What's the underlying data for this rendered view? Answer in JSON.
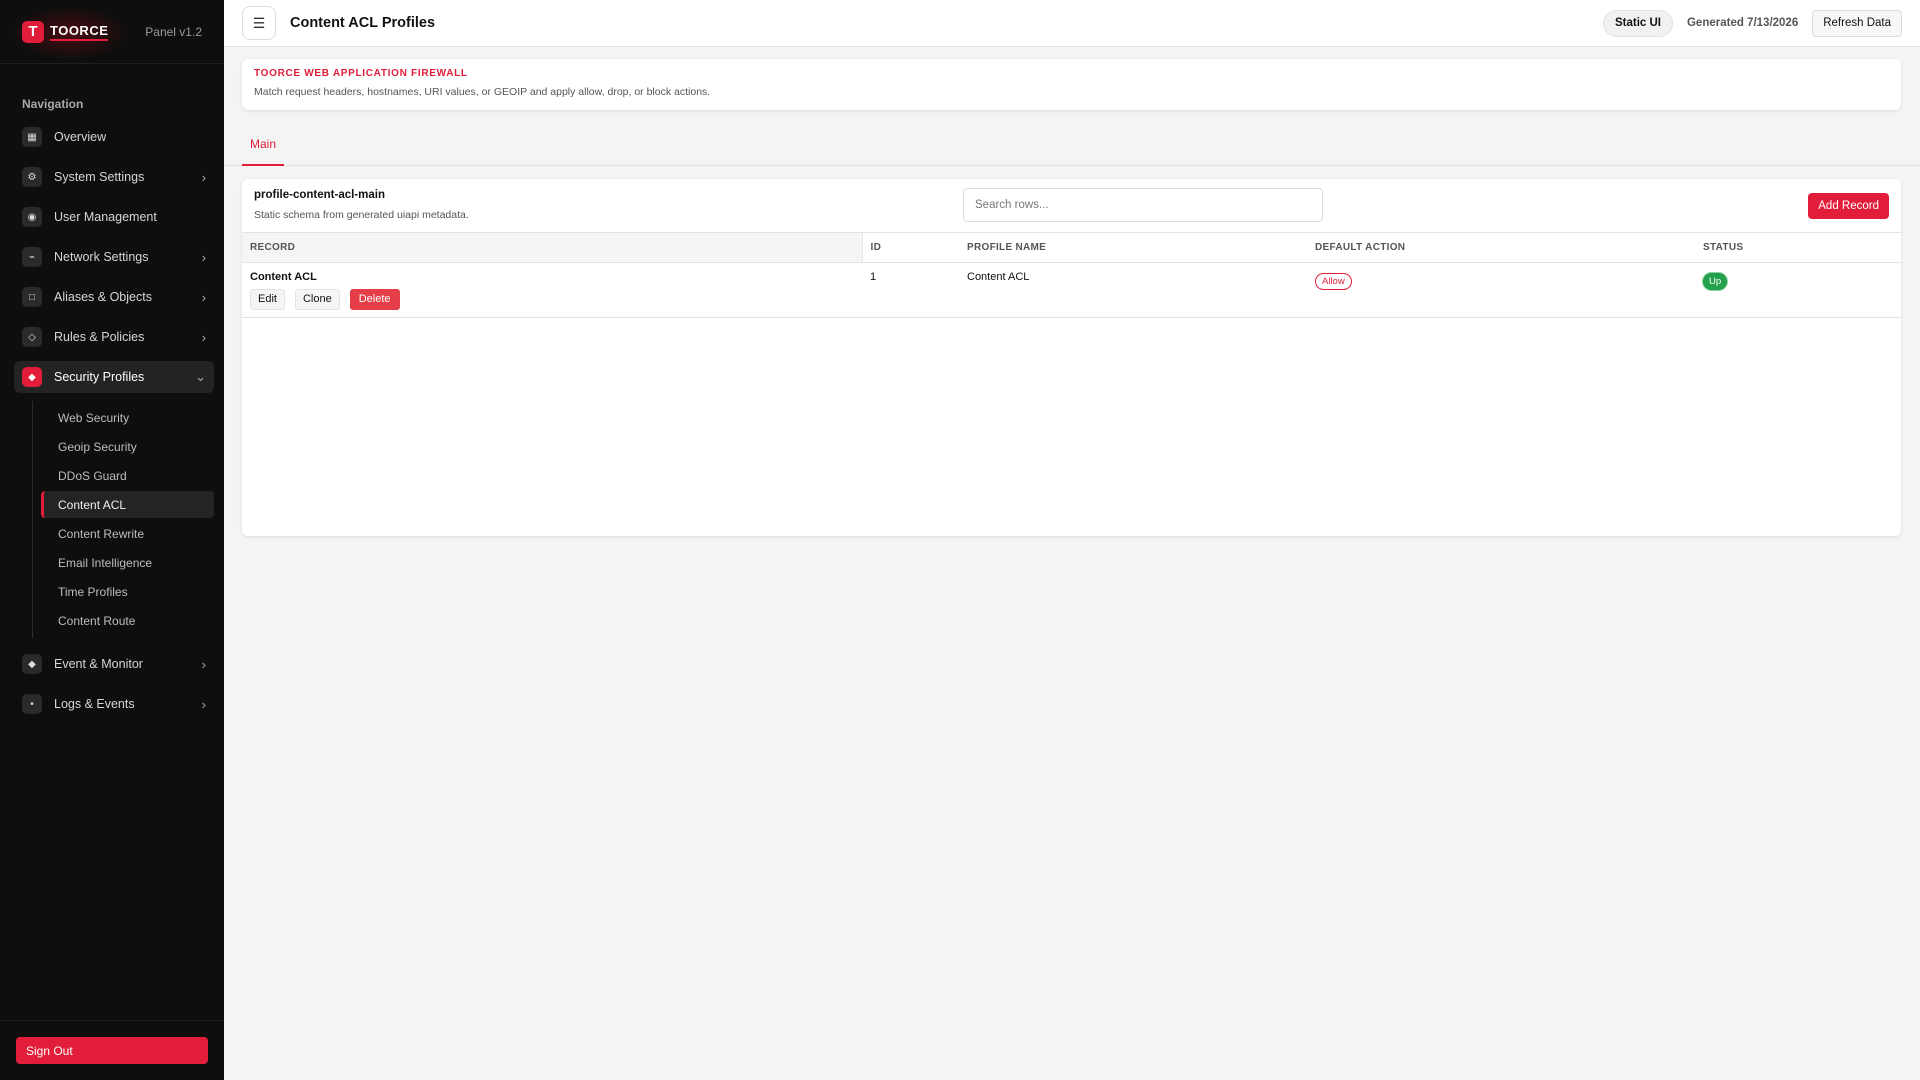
{
  "brand": {
    "logo_letter": "T",
    "name": "TOORCE",
    "panel_version": "Panel v1.2"
  },
  "sidebar": {
    "heading": "Navigation",
    "items": [
      {
        "label": "Overview",
        "icon": "grid-icon",
        "glyph": "▦"
      },
      {
        "label": "System Settings",
        "icon": "gear-icon",
        "glyph": "⚙",
        "chevron": "›"
      },
      {
        "label": "User Management",
        "icon": "user-icon",
        "glyph": "◉"
      },
      {
        "label": "Network Settings",
        "icon": "network-icon",
        "glyph": "⌁",
        "chevron": "›"
      },
      {
        "label": "Aliases & Objects",
        "icon": "square-icon",
        "glyph": "□",
        "chevron": "›"
      },
      {
        "label": "Rules & Policies",
        "icon": "diamond-outline-icon",
        "glyph": "◇",
        "chevron": "›"
      },
      {
        "label": "Security Profiles",
        "icon": "shield-icon",
        "glyph": "◆",
        "chevron": "⌄"
      }
    ],
    "security_sub_items": [
      "Web Security",
      "Geoip Security",
      "DDoS Guard",
      "Content ACL",
      "Content Rewrite",
      "Email Intelligence",
      "Time Profiles",
      "Content Route"
    ],
    "bottom_items": [
      {
        "label": "Event & Monitor",
        "icon": "diamond-icon",
        "glyph": "◆",
        "chevron": "›"
      },
      {
        "label": "Logs & Events",
        "icon": "dot-icon",
        "glyph": "•",
        "chevron": "›"
      }
    ],
    "sign_out": "Sign Out"
  },
  "topbar": {
    "menu_glyph": "☰",
    "title": "Content ACL Profiles",
    "static_ui": "Static UI",
    "generated": "Generated 7/13/2026",
    "refresh": "Refresh Data"
  },
  "banner": {
    "title": "TOORCE WEB APPLICATION FIREWALL",
    "subtitle": "Match request headers, hostnames, URI values, or GEOIP and apply allow, drop, or block actions."
  },
  "tabs": [
    "Main"
  ],
  "card": {
    "title": "profile-content-acl-main",
    "subtitle": "Static schema from generated uiapi metadata.",
    "search_placeholder": "Search rows...",
    "add_record": "Add Record",
    "columns": [
      "RECORD",
      "ID",
      "PROFILE NAME",
      "DEFAULT ACTION",
      "STATUS"
    ],
    "rows": [
      {
        "record": "Content ACL",
        "id": "1",
        "profile_name": "Content ACL",
        "default_action": "Allow",
        "status": "Up"
      }
    ],
    "row_actions": {
      "edit": "Edit",
      "clone": "Clone",
      "delete": "Delete"
    }
  },
  "colors": {
    "accent": "#e11d39",
    "sidebar_bg": "#0e0e0e",
    "status_up": "#22a04b"
  }
}
